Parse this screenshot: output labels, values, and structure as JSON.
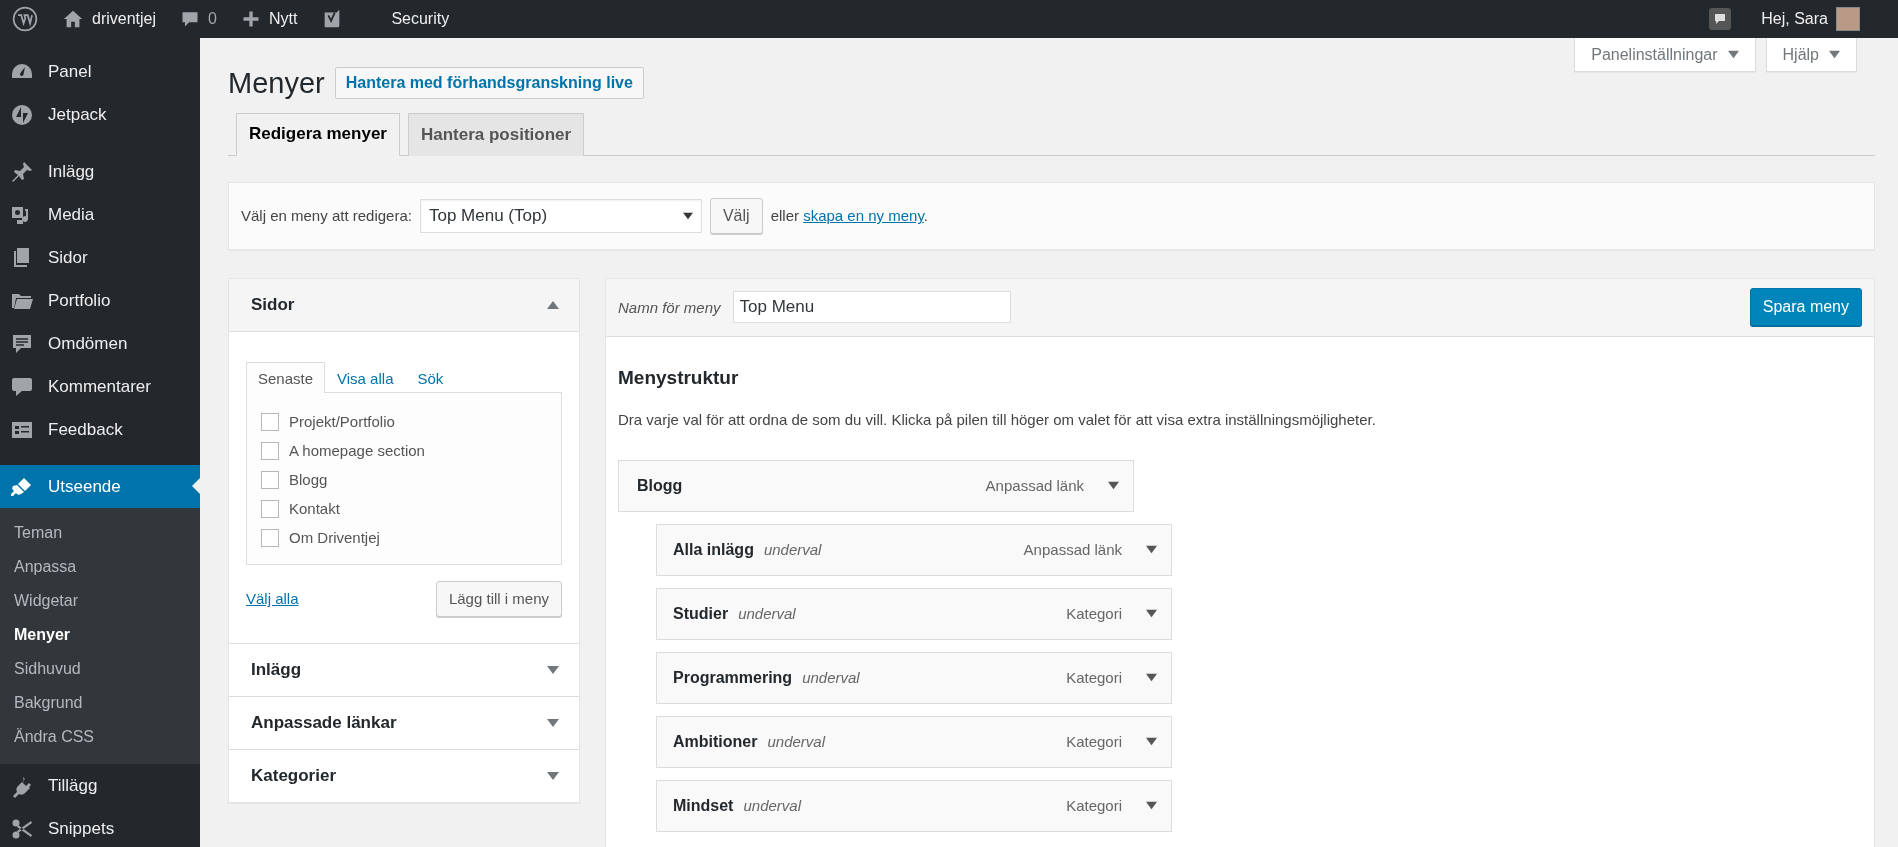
{
  "admin_bar": {
    "items": [
      {
        "kind": "wp-logo"
      },
      {
        "kind": "home",
        "label": "driventjej"
      },
      {
        "kind": "comments",
        "label": "0"
      },
      {
        "kind": "new",
        "label": "Nytt"
      },
      {
        "kind": "seo"
      },
      {
        "kind": "text",
        "label": "Security"
      }
    ],
    "greeting": "Hej, Sara"
  },
  "sidebar": {
    "groups": [
      {
        "items": [
          {
            "kind": "dashboard",
            "label": "Panel",
            "selected": false
          },
          {
            "kind": "jetpack",
            "label": "Jetpack",
            "selected": false
          }
        ]
      },
      {
        "items": [
          {
            "kind": "pin",
            "label": "Inlägg",
            "selected": false
          },
          {
            "kind": "media",
            "label": "Media",
            "selected": false
          },
          {
            "kind": "pages",
            "label": "Sidor",
            "selected": false
          },
          {
            "kind": "folder",
            "label": "Portfolio",
            "selected": false
          },
          {
            "kind": "testimonial",
            "label": "Omdömen",
            "selected": false
          },
          {
            "kind": "comment",
            "label": "Kommentarer",
            "selected": false
          },
          {
            "kind": "feedback",
            "label": "Feedback",
            "selected": false
          }
        ]
      },
      {
        "items": [
          {
            "kind": "brush",
            "label": "Utseende",
            "selected": true,
            "children": [
              {
                "label": "Teman",
                "selected": false
              },
              {
                "label": "Anpassa",
                "selected": false
              },
              {
                "label": "Widgetar",
                "selected": false
              },
              {
                "label": "Menyer",
                "selected": true
              },
              {
                "label": "Sidhuvud",
                "selected": false
              },
              {
                "label": "Bakgrund",
                "selected": false
              },
              {
                "label": "Ändra CSS",
                "selected": false
              }
            ]
          },
          {
            "kind": "plug",
            "label": "Tillägg",
            "selected": false
          },
          {
            "kind": "scissors",
            "label": "Snippets",
            "selected": false
          }
        ]
      }
    ]
  },
  "screen_options": [
    {
      "label": "Panelinställningar"
    },
    {
      "label": "Hjälp"
    }
  ],
  "page": {
    "title": "Menyer",
    "title_action": "Hantera med förhandsgranskning live",
    "tabs": [
      {
        "label": "Redigera menyer",
        "selected": true
      },
      {
        "label": "Hantera positioner",
        "selected": false
      }
    ]
  },
  "menu_select": {
    "label": "Välj en meny att redigera:",
    "value": "Top Menu (Top)",
    "button": "Välj",
    "text_before": "eller",
    "link": "skapa en ny meny",
    "text_after": "."
  },
  "add_items": {
    "sections": [
      {
        "title": "Sidor",
        "expanded": true,
        "tabs": [
          {
            "label": "Senaste",
            "selected": true
          },
          {
            "label": "Visa alla",
            "selected": false
          },
          {
            "label": "Sök",
            "selected": false
          }
        ],
        "checklist": [
          {
            "label": "Projekt/Portfolio",
            "checked": false
          },
          {
            "label": "A homepage section",
            "checked": false
          },
          {
            "label": "Blogg",
            "checked": false
          },
          {
            "label": "Kontakt",
            "checked": false
          },
          {
            "label": "Om Driventjej",
            "checked": false
          }
        ],
        "select_all": "Välj alla",
        "add_button": "Lägg till i meny"
      },
      {
        "title": "Inlägg",
        "expanded": false
      },
      {
        "title": "Anpassade länkar",
        "expanded": false
      },
      {
        "title": "Kategorier",
        "expanded": false
      }
    ]
  },
  "menu_editor": {
    "name_label": "Namn för meny",
    "name_value": "Top Menu",
    "save_button": "Spara meny",
    "heading": "Menystruktur",
    "description": "Dra varje val för att ordna de som du vill. Klicka på pilen till höger om valet för att visa extra inställningsmöjligheter.",
    "items": [
      {
        "title": "Blogg",
        "type": "Anpassad länk",
        "children": [
          {
            "title": "Alla inlägg",
            "note": "underval",
            "type": "Anpassad länk"
          },
          {
            "title": "Studier",
            "note": "underval",
            "type": "Kategori"
          },
          {
            "title": "Programmering",
            "note": "underval",
            "type": "Kategori"
          },
          {
            "title": "Ambitioner",
            "note": "underval",
            "type": "Kategori"
          },
          {
            "title": "Mindset",
            "note": "underval",
            "type": "Kategori"
          }
        ]
      }
    ]
  }
}
